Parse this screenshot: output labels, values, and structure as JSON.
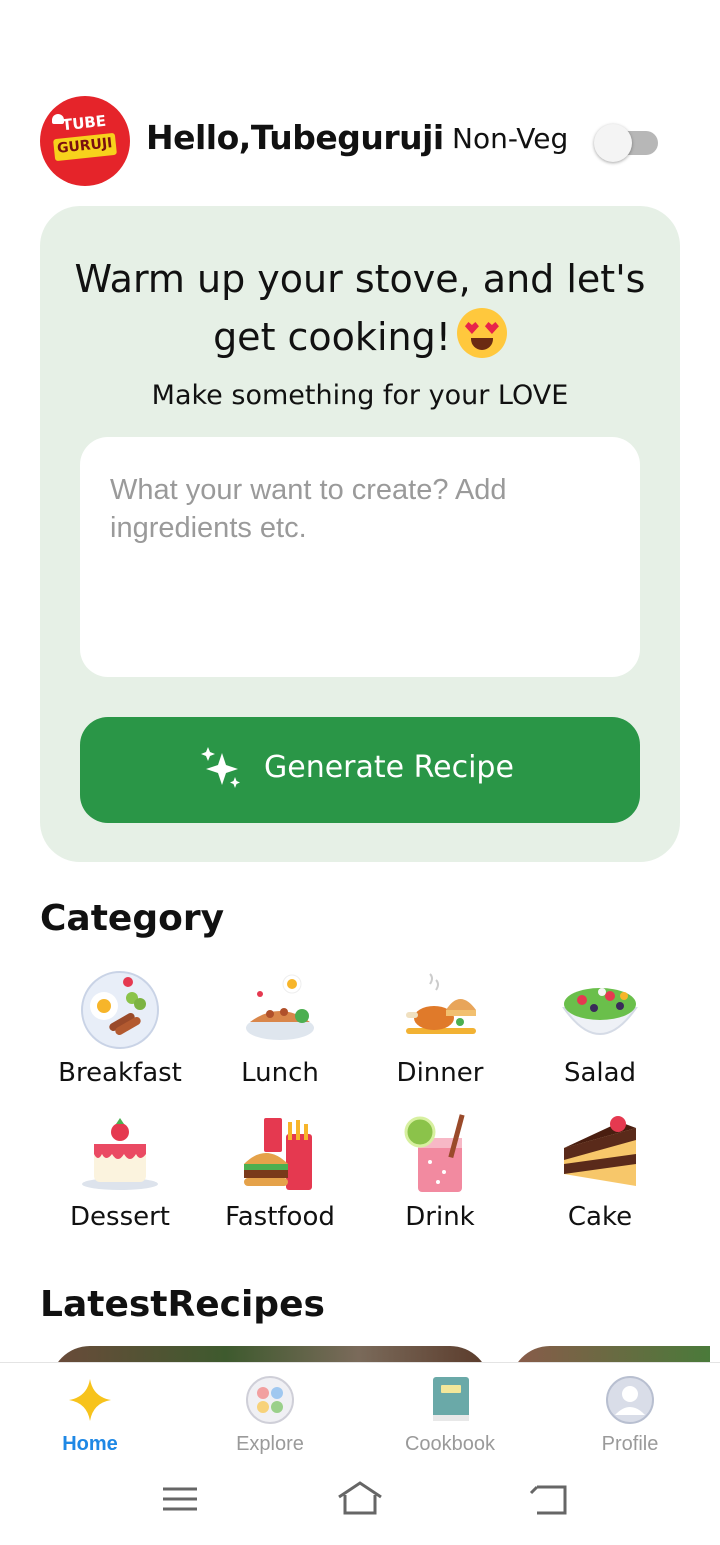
{
  "header": {
    "logo_text_top": "TUBE",
    "logo_text_bottom": "GURUJI",
    "greeting": "Hello,Tubeguruji",
    "diet_label": "Non-Veg",
    "diet_toggle_on": false
  },
  "hero": {
    "title": "Warm up your stove, and let's get cooking!",
    "emoji": "heart-eyes-emoji",
    "subtitle": "Make something for your LOVE",
    "prompt_placeholder": "What your want to create? Add ingredients etc.",
    "prompt_value": "",
    "generate_label": "Generate Recipe"
  },
  "category": {
    "title": "Category",
    "items": [
      {
        "label": "Breakfast",
        "icon": "breakfast-icon"
      },
      {
        "label": "Lunch",
        "icon": "lunch-icon"
      },
      {
        "label": "Dinner",
        "icon": "dinner-icon"
      },
      {
        "label": "Salad",
        "icon": "salad-icon"
      },
      {
        "label": "Dessert",
        "icon": "dessert-icon"
      },
      {
        "label": "Fastfood",
        "icon": "fastfood-icon"
      },
      {
        "label": "Drink",
        "icon": "drink-icon"
      },
      {
        "label": "Cake",
        "icon": "cake-icon"
      }
    ]
  },
  "latest": {
    "title": "LatestRecipes"
  },
  "nav": {
    "items": [
      {
        "label": "Home",
        "icon": "sparkle-icon",
        "active": true
      },
      {
        "label": "Explore",
        "icon": "explore-icon",
        "active": false
      },
      {
        "label": "Cookbook",
        "icon": "book-icon",
        "active": false
      },
      {
        "label": "Profile",
        "icon": "profile-icon",
        "active": false
      }
    ]
  },
  "colors": {
    "accent_green": "#2a9647",
    "hero_bg": "#e6f0e6",
    "nav_active": "#1e88e5"
  }
}
